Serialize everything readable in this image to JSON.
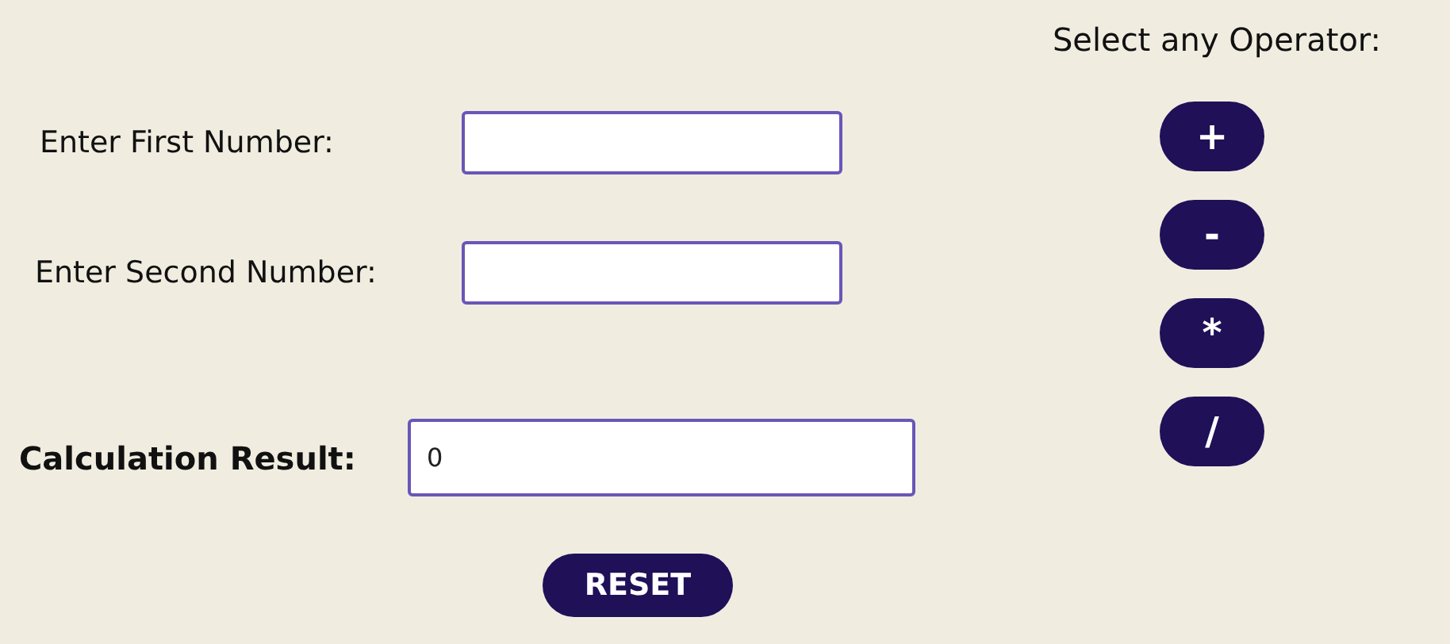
{
  "fields": [
    {
      "label": "Enter First Number:"
    },
    {
      "label": "Enter Second Number:"
    }
  ],
  "result": {
    "label": "Calculation Result:",
    "value": "0"
  },
  "reset_button": "RESET",
  "operators": {
    "title": "Select any Operator:",
    "buttons": [
      "+",
      "-",
      "*",
      "/"
    ]
  }
}
